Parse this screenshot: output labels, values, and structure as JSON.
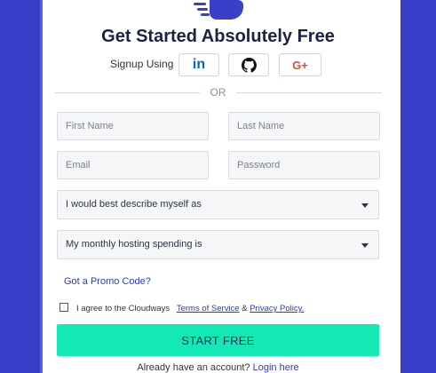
{
  "header": {
    "title": "Get Started Absolutely Free"
  },
  "signup": {
    "label": "Signup Using",
    "linkedin_label": "in",
    "google_label": "G+"
  },
  "divider": {
    "or": "OR"
  },
  "form": {
    "first_name_placeholder": "First Name",
    "last_name_placeholder": "Last Name",
    "email_placeholder": "Email",
    "password_placeholder": "Password",
    "describe_select": "I would best describe myself as",
    "spending_select": "My monthly hosting spending is"
  },
  "promo": {
    "label": "Got a Promo Code?"
  },
  "terms": {
    "prefix": "I agree to the Cloudways",
    "terms_link": "Terms of Service",
    "amp": "&",
    "privacy_link": "Privacy Policy."
  },
  "cta": {
    "start_label": "START FREE"
  },
  "footer": {
    "prompt": "Already have an account?",
    "login_link": "Login here"
  },
  "colors": {
    "background": "#3a3fc9",
    "accent_green": "#14e8b4",
    "link_blue": "#2b3bb5",
    "linkedin_blue": "#0a66c2",
    "google_red": "#dd4b39"
  }
}
